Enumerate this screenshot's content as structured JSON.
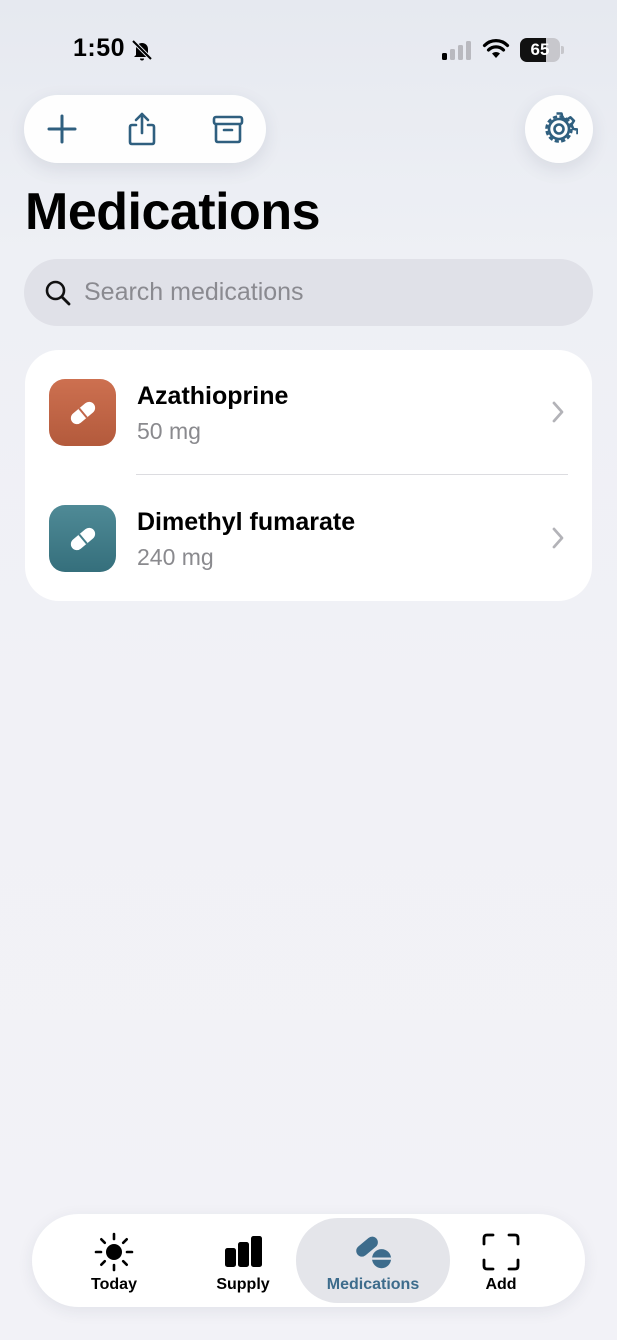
{
  "status_bar": {
    "time": "1:50",
    "battery_percent": "65",
    "battery_level": 0.65
  },
  "toolbar": {
    "icons": [
      "plus-icon",
      "share-icon",
      "archive-icon"
    ],
    "settings_icon": "gear-icon"
  },
  "page": {
    "title": "Medications"
  },
  "search": {
    "placeholder": "Search medications",
    "value": ""
  },
  "medications": [
    {
      "name": "Azathioprine",
      "dose": "50 mg",
      "icon_color": "#c2664a",
      "icon": "pill-icon"
    },
    {
      "name": "Dimethyl fumarate",
      "dose": "240 mg",
      "icon_color": "#437d89",
      "icon": "pill-icon"
    }
  ],
  "tab_bar": {
    "tabs": [
      {
        "label": "Today",
        "icon": "sun-icon"
      },
      {
        "label": "Supply",
        "icon": "bar-chart-icon"
      },
      {
        "label": "Medications",
        "icon": "pills-icon",
        "active": true
      },
      {
        "label": "Add",
        "icon": "scan-frame-icon"
      }
    ],
    "accent": "#3d6c8c"
  }
}
